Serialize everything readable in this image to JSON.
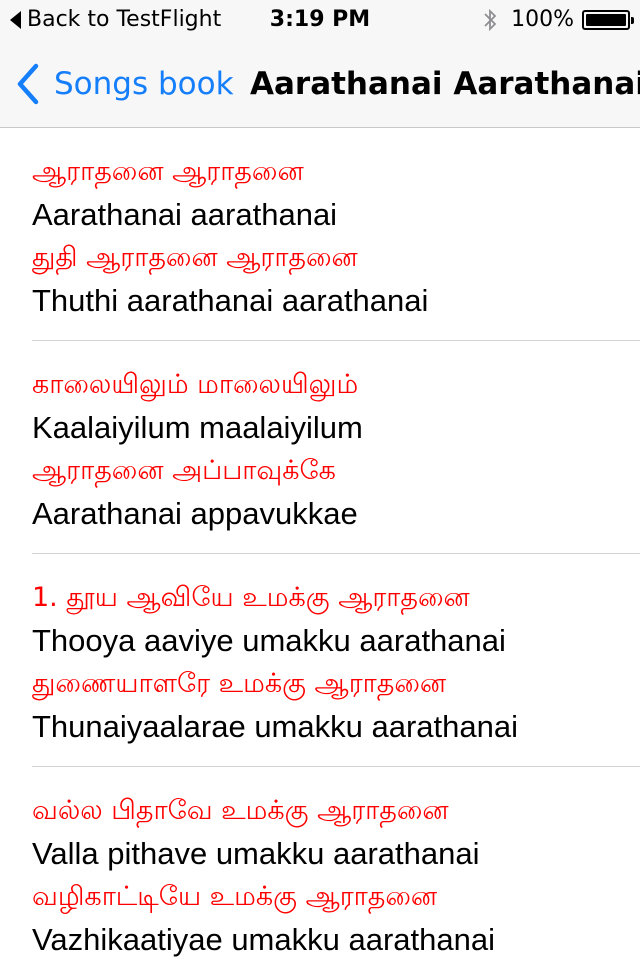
{
  "status_bar": {
    "back_label": "Back to TestFlight",
    "time": "3:19 PM",
    "battery_percent": "100%",
    "battery_level": 1.0
  },
  "nav": {
    "back_label": "Songs book",
    "title": "Aarathanai Aarathanai"
  },
  "stanzas": [
    {
      "lines": [
        {
          "tamil": "ஆராதனை ஆராதனை",
          "english": "Aarathanai aarathanai"
        },
        {
          "tamil": "துதி ஆராதனை ஆராதனை",
          "english": "Thuthi aarathanai aarathanai"
        }
      ]
    },
    {
      "lines": [
        {
          "tamil": "காலையிலும் மாலையிலும்",
          "english": "Kaalaiyilum maalaiyilum"
        },
        {
          "tamil": "ஆராதனை அப்பாவுக்கே",
          "english": "Aarathanai appavukkae"
        }
      ]
    },
    {
      "lines": [
        {
          "tamil": "1. தூய ஆவியே உமக்கு ஆராதனை",
          "english": "Thooya aaviye umakku aarathanai"
        },
        {
          "tamil": "துணையாளரே உமக்கு ஆராதனை",
          "english": "Thunaiyaalarae umakku aarathanai"
        }
      ]
    },
    {
      "lines": [
        {
          "tamil": "வல்ல பிதாவே உமக்கு ஆராதனை",
          "english": "Valla pithave umakku aarathanai"
        },
        {
          "tamil": "வழிகாட்டியே உமக்கு ஆராதனை",
          "english": "Vazhikaatiyae umakku aarathanai"
        }
      ]
    }
  ]
}
